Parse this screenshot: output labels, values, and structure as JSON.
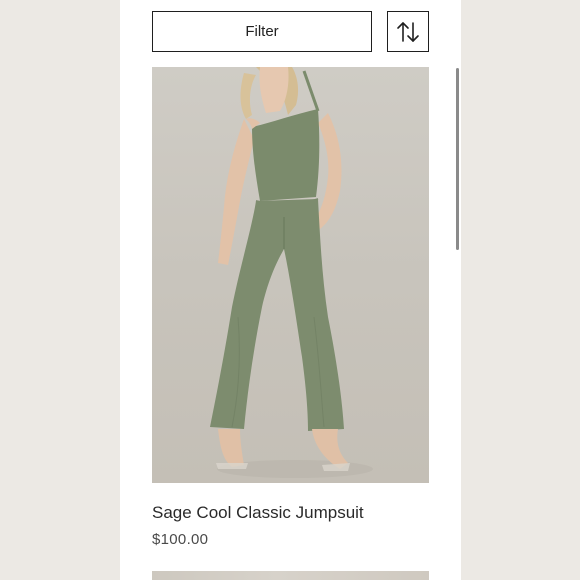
{
  "toolbar": {
    "filter_label": "Filter",
    "sort_icon": "sort-arrows-icon"
  },
  "products": [
    {
      "name": "Sage Cool Classic Jumpsuit",
      "price": "$100.00",
      "image": "model-in-sage-green-one-shoulder-jumpsuit",
      "color": "#7d8c6e"
    }
  ],
  "colors": {
    "background": "#ece9e4",
    "card": "#ffffff",
    "border": "#1f1f1f"
  }
}
